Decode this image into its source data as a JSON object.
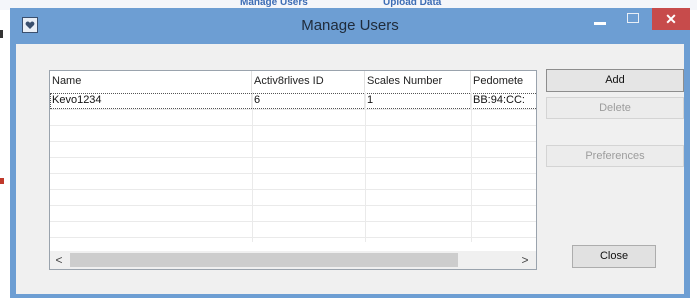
{
  "background": {
    "tabs": [
      "Manage Users",
      "Upload Data"
    ]
  },
  "window": {
    "title": "Manage Users",
    "close_glyph": "✕"
  },
  "list": {
    "columns": [
      "Name",
      "Activ8rlives ID",
      "Scales Number",
      "Pedomete"
    ],
    "rows": [
      [
        "Kevo1234",
        "6",
        "1",
        "BB:94:CC:"
      ]
    ],
    "scroll_left": "<",
    "scroll_right": ">"
  },
  "buttons": {
    "add": "Add",
    "delete": "Delete",
    "preferences": "Preferences",
    "close": "Close"
  },
  "colors": {
    "titlebar": "#6d9ed3",
    "close_button": "#c74b4b",
    "client_background": "#f0f0f0"
  }
}
